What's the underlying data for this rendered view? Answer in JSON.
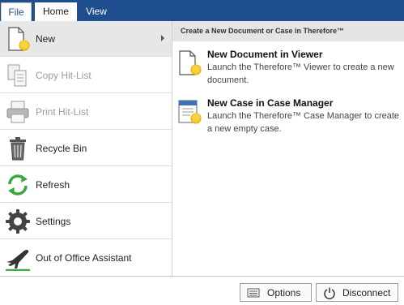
{
  "ribbon": {
    "tabs": [
      {
        "label": "File",
        "icon": "none"
      },
      {
        "label": "Home",
        "icon": "none"
      },
      {
        "label": "View",
        "icon": "none"
      }
    ]
  },
  "menu": {
    "items": [
      {
        "label": "New",
        "icon": "new-document-icon",
        "state": "selected"
      },
      {
        "label": "Copy Hit-List",
        "icon": "copy-icon",
        "state": "disabled"
      },
      {
        "label": "Print Hit-List",
        "icon": "printer-icon",
        "state": "disabled"
      },
      {
        "label": "Recycle Bin",
        "icon": "trash-icon",
        "state": "enabled"
      },
      {
        "label": "Refresh",
        "icon": "refresh-icon",
        "state": "enabled"
      },
      {
        "label": "Settings",
        "icon": "gear-icon",
        "state": "enabled"
      },
      {
        "label": "Out of Office Assistant",
        "icon": "airplane-icon",
        "state": "enabled"
      }
    ]
  },
  "submenu": {
    "header": "Create a New Document or Case in Therefore™",
    "entries": [
      {
        "title": "New Document in Viewer",
        "description": "Launch the Therefore™ Viewer to create a new document.",
        "icon": "new-document-icon"
      },
      {
        "title": "New Case in Case Manager",
        "description": "Launch the Therefore™ Case Manager to create a new empty case.",
        "icon": "new-case-icon"
      }
    ]
  },
  "footer": {
    "options_label": "Options",
    "disconnect_label": "Disconnect"
  },
  "colors": {
    "ribbon": "#1f4e8f",
    "selected_item": "#e7e7e7",
    "header_bar": "#e4e4e4",
    "sparkle": "#f5c518",
    "refresh_green": "#3aa83f"
  }
}
